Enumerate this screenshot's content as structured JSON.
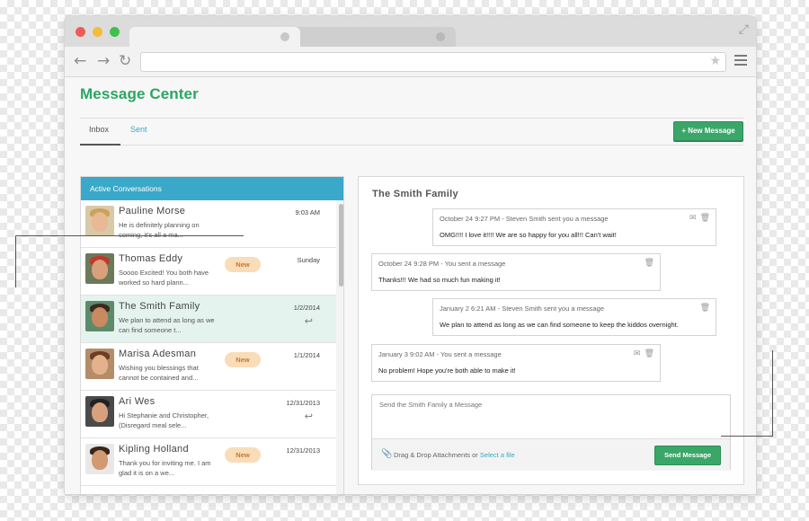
{
  "app": {
    "title": "Message Center"
  },
  "tabs": {
    "inbox": "Inbox",
    "sent": "Sent"
  },
  "new_message_button": "+ New Message",
  "left_panel": {
    "header": "Active Conversations",
    "conversations": [
      {
        "name": "Pauline Morse",
        "snippet": "He is definitely planning on coming, it's all a ma...",
        "date": "9:03 AM",
        "badge": ""
      },
      {
        "name": "Thomas Eddy",
        "snippet": "Soooo Excited! You both have worked so hard plann...",
        "date": "Sunday",
        "badge": "New"
      },
      {
        "name": "The Smith Family",
        "snippet": "We plan to attend as long as we can find someone t...",
        "date": "1/2/2014",
        "badge": ""
      },
      {
        "name": "Marisa Adesman",
        "snippet": "Wishing you blessings that cannot be contained and...",
        "date": "1/1/2014",
        "badge": "New"
      },
      {
        "name": "Ari Wes",
        "snippet": "Hi Stephanie and Christopher, (Disregard meal sele...",
        "date": "12/31/2013",
        "badge": ""
      },
      {
        "name": "Kipling Holland",
        "snippet": "Thank you for inviting me. I am glad it is on a we...",
        "date": "12/31/2013",
        "badge": "New"
      }
    ]
  },
  "conversation": {
    "title": "The Smith Family",
    "messages": [
      {
        "meta": "October 24 9:27 PM - Steven Smith sent you a message",
        "body": "OMG!!!! I love it!!!! We are so happy for you all!!! Can't wait!"
      },
      {
        "meta": "October 24 9:28 PM - You sent a message",
        "body": "Thanks!!! We had so much fun making it!"
      },
      {
        "meta": "January 2 6:21 AM - Steven Smith sent you a message",
        "body": "We plan to attend as long as we can find someone to keep the kiddos overnight."
      },
      {
        "meta": "January 3 9:02 AM - You sent a message",
        "body": "No problem! Hope you're both able to make it!"
      }
    ],
    "compose_placeholder": "Send the Smith Family a Message",
    "attach_text": "Drag & Drop Attachments or",
    "attach_link": "Select a file",
    "send_button": "Send Message"
  },
  "colors": {
    "accent_green": "#3aa768",
    "header_teal": "#3aa9c9",
    "badge_bg": "#f9dcb8",
    "selected_row": "#e4f3ed"
  }
}
